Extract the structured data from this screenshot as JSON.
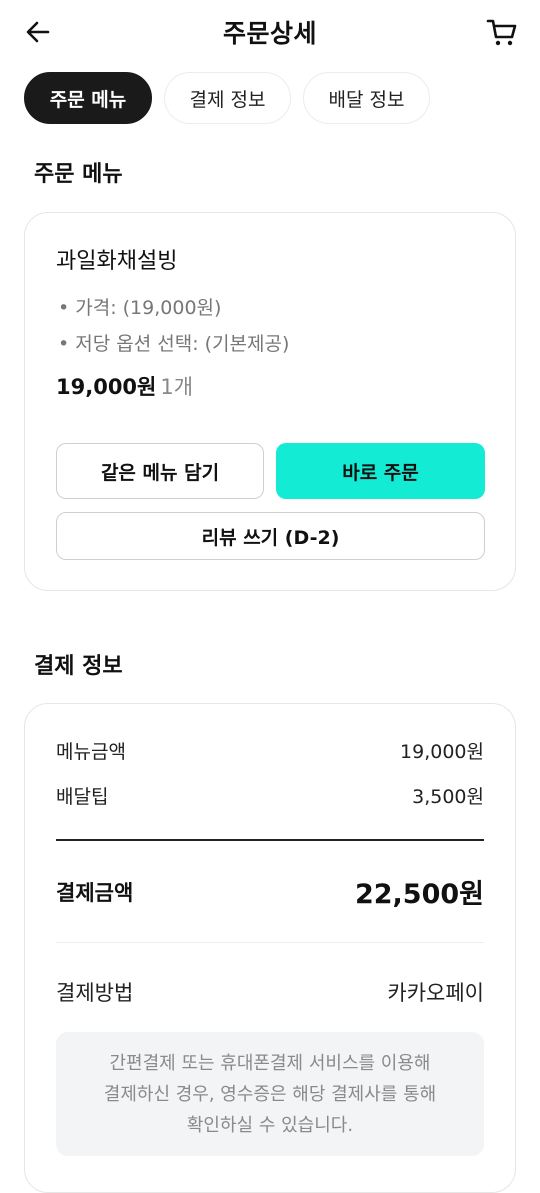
{
  "header": {
    "title": "주문상세",
    "back_icon": "arrow-left-icon",
    "cart_icon": "cart-icon"
  },
  "tabs": [
    {
      "label": "주문 메뉴",
      "active": true
    },
    {
      "label": "결제 정보",
      "active": false
    },
    {
      "label": "배달 정보",
      "active": false
    }
  ],
  "order_menu": {
    "section_title": "주문 메뉴",
    "item": {
      "name": "과일화채설빙",
      "options": [
        "• 가격:  (19,000원)",
        "• 저당 옵션 선택: (기본제공)"
      ],
      "price": "19,000원",
      "quantity": "1개"
    },
    "buttons": {
      "add_same": "같은 메뉴 담기",
      "order_now": "바로 주문",
      "write_review": "리뷰 쓰기 (D-2)"
    }
  },
  "payment": {
    "section_title": "결제 정보",
    "rows": [
      {
        "label": "메뉴금액",
        "value": "19,000원"
      },
      {
        "label": "배달팁",
        "value": "3,500원"
      }
    ],
    "total_label": "결제금액",
    "total_value": "22,500원",
    "method_label": "결제방법",
    "method_value": "카카오페이",
    "notice": "간편결제 또는 휴대폰결제 서비스를 이용해\n결제하신 경우, 영수증은 해당 결제사를 통해\n확인하실 수 있습니다."
  },
  "colors": {
    "accent": "#14ebd4",
    "tab_active_bg": "#1a1a1a"
  }
}
